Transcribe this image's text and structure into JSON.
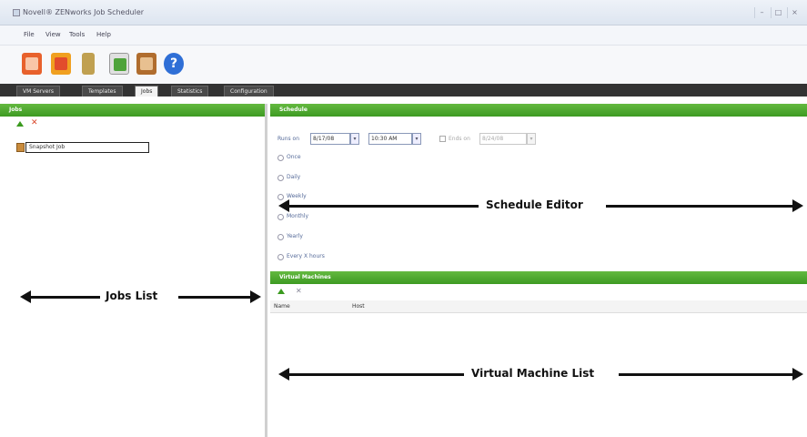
{
  "window": {
    "title": "Novell® ZENworks Job Scheduler",
    "controls": [
      "–",
      "□",
      "×"
    ]
  },
  "menu": [
    "File",
    "View",
    "Tools",
    "Help"
  ],
  "toolbar": {
    "buttons": [
      {
        "icon": "save-icon",
        "color": "#e8612c"
      },
      {
        "icon": "calendar-icon",
        "color": "#f0a020"
      },
      {
        "icon": "battery-icon",
        "color": "#c0a050"
      },
      {
        "icon": "spreadsheet-icon",
        "color": "#4ea33a"
      },
      {
        "icon": "vm-icon",
        "color": "#b06d2e"
      },
      {
        "icon": "help-icon",
        "color": "#2f6fd6"
      }
    ]
  },
  "tabs": [
    "VM Servers",
    "Templates",
    "Jobs",
    "Statistics",
    "Configuration"
  ],
  "jobs": {
    "header": "Jobs",
    "items": [
      {
        "label": "Snapshot Job"
      }
    ]
  },
  "schedule": {
    "header": "Schedule",
    "runs_on_label": "Runs on",
    "start_date": "8/17/08",
    "start_time": "10:30 AM",
    "ends_label": "Ends on",
    "end_date": "8/24/08",
    "options": [
      "Once",
      "Daily",
      "Weekly",
      "Monthly",
      "Yearly",
      "Every X hours"
    ]
  },
  "vms": {
    "header": "Virtual Machines",
    "columns": [
      "Name",
      "Host"
    ]
  },
  "annotations": {
    "schedule_editor": "Schedule Editor",
    "jobs_list": "Jobs List",
    "vm_list": "Virtual Machine List"
  }
}
